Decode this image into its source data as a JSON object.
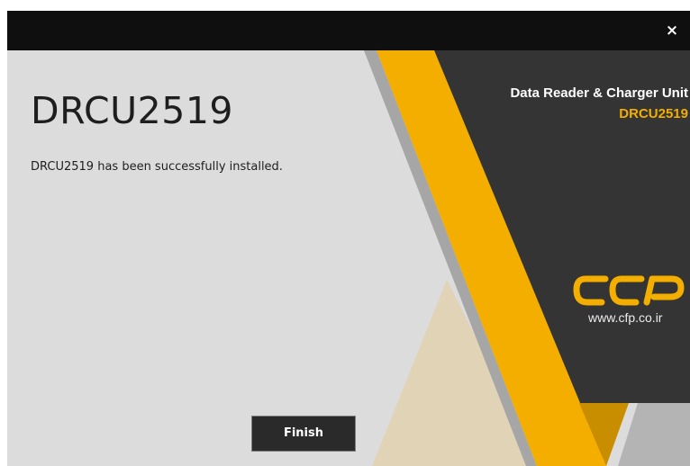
{
  "window": {
    "close_glyph": "×"
  },
  "main": {
    "heading": "DRCU2519",
    "message": "DRCU2519 has been successfully installed."
  },
  "banner": {
    "product_title": "Data Reader & Charger Unit",
    "product_model": "DRCU2519",
    "logo_icon": "cfp-logo-icon",
    "url": "www.cfp.co.ir",
    "colors": {
      "accent": "#f4ae00",
      "panel": "#343434",
      "background": "#dcdcdc",
      "tan": "#e0d3b6"
    }
  },
  "footer": {
    "finish_label": "Finish"
  }
}
